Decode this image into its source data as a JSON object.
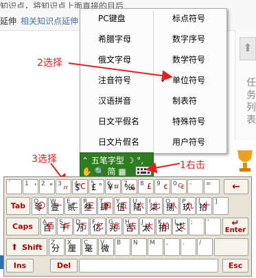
{
  "background": {
    "line1": "知识点，将知识点上面直接的目后",
    "line2_a": "延伸",
    "line2_b": "相关知识点延伸",
    "right_chars": [
      "任",
      "务",
      "列",
      "表"
    ]
  },
  "menu": {
    "left": [
      "PC键盘",
      "希腊字母",
      "俄文字母",
      "注音符号",
      "汉语拼音",
      "日文平假名",
      "日文片假名"
    ],
    "right": [
      "标点符号",
      "数字序号",
      "数学符号",
      "单位符号",
      "制表符",
      "特殊符号",
      "用户符号"
    ],
    "checked_item": "单位符号",
    "check_mark": "✔"
  },
  "ime": {
    "row1": "⌃ 五笔字型  ☽ °,",
    "row2": "✋ 🔍 简 ▦"
  },
  "annotations": {
    "step1": "1右击",
    "step2": "2选择",
    "step3": "3选择"
  },
  "keyboard": {
    "row0": [
      {
        "s": "`",
        "m": "",
        "r": ""
      },
      {
        "s": "1",
        "m": "",
        "r": "'"
      },
      {
        "s": "2",
        "m": "",
        "r": "\""
      },
      {
        "s": "3",
        "m": "",
        "r": "〃"
      },
      {
        "s": "4",
        "m": "$",
        "r": "℃"
      },
      {
        "s": "5",
        "m": "£",
        "r": "°"
      },
      {
        "s": "6",
        "m": "¥",
        "r": "¤"
      },
      {
        "s": "7",
        "m": "‰",
        "r": "¢"
      },
      {
        "s": "8",
        "m": "",
        "r": "£"
      },
      {
        "s": "9",
        "m": "",
        "r": "¢"
      },
      {
        "s": "0",
        "m": "",
        "r": "₠"
      },
      {
        "s": "-",
        "m": "",
        "r": ""
      },
      {
        "s": "=",
        "m": "",
        "r": ""
      }
    ],
    "backspace": "←",
    "tab": "Tab",
    "row1": [
      {
        "s": "Q",
        "m": "零",
        "r": "〇"
      },
      {
        "s": "W",
        "m": "壹",
        "r": "一"
      },
      {
        "s": "E",
        "m": "贰",
        "r": "二"
      },
      {
        "s": "R",
        "m": "叁",
        "r": "三"
      },
      {
        "s": "T",
        "m": "肆",
        "r": "四"
      },
      {
        "s": "Y",
        "m": "伍",
        "r": "五"
      },
      {
        "s": "U",
        "m": "陆",
        "r": "六"
      },
      {
        "s": "I",
        "m": "柒",
        "r": "七"
      },
      {
        "s": "O",
        "m": "捌",
        "r": "八"
      },
      {
        "s": "P",
        "m": "玖",
        "r": "九"
      },
      {
        "s": "[",
        "m": "拾",
        "r": "十"
      },
      {
        "s": "]",
        "m": "",
        "r": ""
      }
    ],
    "caps": "Caps",
    "enter_arrow": "↵",
    "enter": "Enter",
    "row2": [
      {
        "s": "A",
        "m": "百",
        "r": "佰"
      },
      {
        "s": "S",
        "m": "千",
        "r": "仟"
      },
      {
        "s": "D",
        "m": "万",
        "r": "万"
      },
      {
        "s": "F",
        "m": "亿",
        "r": "亿"
      },
      {
        "s": "G",
        "m": "兆",
        "r": "兆"
      },
      {
        "s": "H",
        "m": "吉",
        "r": "吉"
      },
      {
        "s": "J",
        "m": "太",
        "r": "太"
      },
      {
        "s": "K",
        "m": "拍",
        "r": "拍"
      },
      {
        "s": "L",
        "m": "艾",
        "r": "艾"
      },
      {
        "s": ";",
        "m": "",
        "r": ""
      },
      {
        "s": "'",
        "m": "",
        "r": ""
      }
    ],
    "shift_arrow": "⬆",
    "shift": "Shift",
    "row3": [
      {
        "s": "Z",
        "m": "分",
        "r": ""
      },
      {
        "s": "X",
        "m": "厘",
        "r": ""
      },
      {
        "s": "C",
        "m": "毫",
        "r": ""
      },
      {
        "s": "V",
        "m": "微",
        "r": ""
      },
      {
        "s": "B",
        "m": "",
        "r": ""
      },
      {
        "s": "N",
        "m": "",
        "r": ""
      },
      {
        "s": "M",
        "m": "",
        "r": ""
      },
      {
        "s": ",",
        "m": "",
        "r": ""
      },
      {
        "s": ".",
        "m": "",
        "r": ""
      },
      {
        "s": "/",
        "m": "",
        "r": ""
      }
    ],
    "ins": "Ins",
    "del": "Del",
    "esc": "Esc"
  }
}
